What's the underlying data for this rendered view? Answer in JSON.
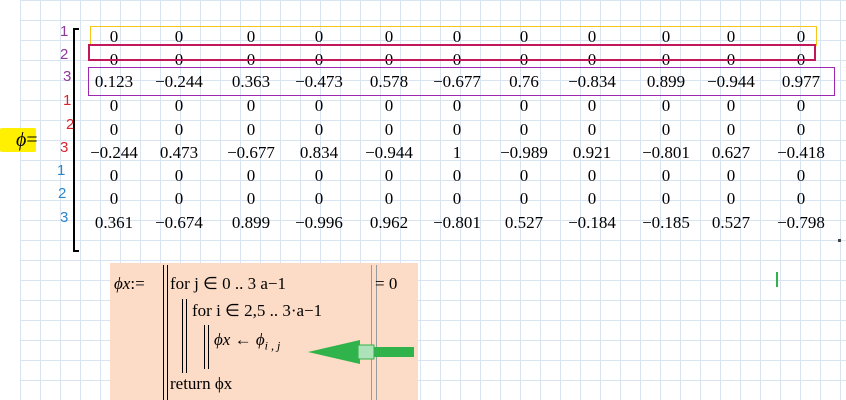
{
  "matrix": {
    "variable": "ϕ",
    "equals": "=",
    "row_labels": [
      {
        "text": "1",
        "color": "#8e3a97"
      },
      {
        "text": "2",
        "color": "#8e3a97"
      },
      {
        "text": "3",
        "color": "#8e3a97"
      },
      {
        "text": "1",
        "color": "#d9262b"
      },
      {
        "text": "2",
        "color": "#d9262b"
      },
      {
        "text": "3",
        "color": "#d9262b"
      },
      {
        "text": "1",
        "color": "#2e86c8"
      },
      {
        "text": "2",
        "color": "#2e86c8"
      },
      {
        "text": "3",
        "color": "#2e86c8"
      }
    ],
    "rows": [
      [
        "0",
        "0",
        "0",
        "0",
        "0",
        "0",
        "0",
        "0",
        "0",
        "0",
        "0"
      ],
      [
        "0",
        "0",
        "0",
        "0",
        "0",
        "0",
        "0",
        "0",
        "0",
        "0",
        "0"
      ],
      [
        "0.123",
        "−0.244",
        "0.363",
        "−0.473",
        "0.578",
        "−0.677",
        "0.76",
        "−0.834",
        "0.899",
        "−0.944",
        "0.977"
      ],
      [
        "0",
        "0",
        "0",
        "0",
        "0",
        "0",
        "0",
        "0",
        "0",
        "0",
        "0"
      ],
      [
        "0",
        "0",
        "0",
        "0",
        "0",
        "0",
        "0",
        "0",
        "0",
        "0",
        "0"
      ],
      [
        "−0.244",
        "0.473",
        "−0.677",
        "0.834",
        "−0.944",
        "1",
        "−0.989",
        "0.921",
        "−0.801",
        "0.627",
        "−0.418"
      ],
      [
        "0",
        "0",
        "0",
        "0",
        "0",
        "0",
        "0",
        "0",
        "0",
        "0",
        "0"
      ],
      [
        "0",
        "0",
        "0",
        "0",
        "0",
        "0",
        "0",
        "0",
        "0",
        "0",
        "0"
      ],
      [
        "0.361",
        "−0.674",
        "0.899",
        "−0.996",
        "0.962",
        "−0.801",
        "0.527",
        "−0.184",
        "−0.185",
        "0.527",
        "−0.798"
      ]
    ],
    "highlight_colors": {
      "row1": "#f5c518",
      "row2": "#c2185b",
      "row3": "#9c27b0",
      "phi": "#ffef00"
    }
  },
  "program": {
    "lhs": "ϕx",
    "assign": ":=",
    "line1": "for j ∈ 0 .. 3 a−1",
    "line2": "for i ∈ 2,5 .. 3·a−1",
    "line3_lhs": "ϕx ← ϕ",
    "line3_sub": "i , j",
    "line4": "return ϕx",
    "result": "= 0",
    "box_color": "#fcdcc6",
    "arrow_color": "#2fb34a"
  },
  "cursor_color": "#2fb34a"
}
